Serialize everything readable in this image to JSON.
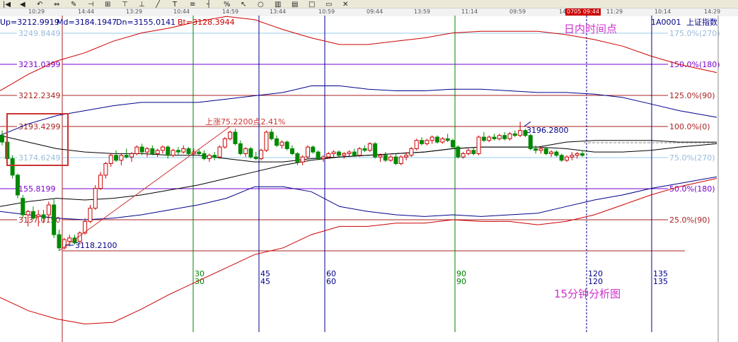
{
  "toolbar": {
    "time_axis_labels": [
      "10:29",
      "14:44",
      "13:29",
      "10:44",
      "14:59",
      "13:44",
      "10:59",
      "09:44",
      "13:59",
      "11:14",
      "09:59",
      "14:",
      "11:29",
      "10:14",
      "14:29"
    ],
    "current_time": "0705 09:44",
    "icons": [
      "first-icon",
      "prev-icon",
      "arrow-icon",
      "adjust-icon",
      "pin-icon",
      "mark-icon",
      "grid-icon",
      "tool-icon",
      "tool2-icon",
      "line-icon",
      "text-icon",
      "fib-icon",
      "ruler-icon",
      "percent-icon",
      "cursor-icon",
      "ring-icon",
      "bars-icon",
      "stack-icon",
      "box-icon",
      "scale-icon",
      "close-icon"
    ]
  },
  "header": {
    "up": "Up=3212.9919",
    "md": "Md=3184.1947",
    "dn": "Dn=3155.0141",
    "bt": "Bt=3128.3944",
    "code": "1A0001",
    "name": "上证指数"
  },
  "annotations": {
    "intraday_time_point": "日内时间点",
    "analysis_title": "15分钟分析图",
    "rise_label": "上涨75.2200点2.41%",
    "low_label": "3118.2100",
    "high_label": "3196.2800"
  },
  "colors": {
    "up_candle": "#cc0000",
    "down_candle": "#008800",
    "bollinger_upper": "#cc0000",
    "bollinger_mid": "#000000",
    "bollinger_lower": "#cc0000",
    "long_band": "#00008b",
    "fib_line_purple": "#7a00cc",
    "fib_line_red": "#aa2222",
    "fib_line_light": "#99ccee",
    "time_line_green": "#008000",
    "time_line_blue": "#000088",
    "highlight_box": "#cc3333",
    "annotation_magenta": "#cc33cc"
  },
  "chart_data": {
    "type": "candlestick",
    "interval": "15分钟",
    "y_levels": [
      {
        "price": "3249.8449",
        "pct": "175.0%(270)"
      },
      {
        "price": "3231.0399",
        "pct": "150.0%(180)"
      },
      {
        "price": "3212.2349",
        "pct": "125.0%(90)"
      },
      {
        "price": "3193.4299",
        "pct": "100.0%(0)"
      },
      {
        "price": "3174.6249",
        "pct": "75.0%(270)"
      },
      {
        "price": "155.8199",
        "pct": "50.0%(180)"
      },
      {
        "price": "3137.0150",
        "pct": "25.0%(90)"
      }
    ],
    "time_count_lines": [
      {
        "top": "30",
        "bottom": "30"
      },
      {
        "top": "45",
        "bottom": "45"
      },
      {
        "top": "60",
        "bottom": "60"
      },
      {
        "top": "90",
        "bottom": "90"
      },
      {
        "top": "120",
        "bottom": "120"
      },
      {
        "top": "135",
        "bottom": "135"
      }
    ],
    "ylim": [
      3105,
      3262
    ],
    "low": 3118.21,
    "high": 3196.28,
    "rise_points": 75.22,
    "rise_percent": 2.41,
    "candles": [
      [
        3188,
        3191,
        3182,
        3184
      ],
      [
        3184,
        3186,
        3172,
        3174
      ],
      [
        3174,
        3176,
        3162,
        3164
      ],
      [
        3164,
        3165,
        3150,
        3152
      ],
      [
        3150,
        3152,
        3138,
        3140
      ],
      [
        3140,
        3143,
        3133,
        3142
      ],
      [
        3142,
        3145,
        3137,
        3138
      ],
      [
        3139,
        3143,
        3133,
        3140
      ],
      [
        3140,
        3143,
        3135,
        3138
      ],
      [
        3140,
        3148,
        3138,
        3146
      ],
      [
        3146,
        3150,
        3126,
        3128
      ],
      [
        3128,
        3131,
        3118.21,
        3120
      ],
      [
        3120,
        3126,
        3119,
        3125
      ],
      [
        3124,
        3128,
        3121,
        3126
      ],
      [
        3126,
        3128,
        3122,
        3123
      ],
      [
        3124,
        3130,
        3122,
        3129
      ],
      [
        3129,
        3138,
        3128,
        3136
      ],
      [
        3136,
        3146,
        3135,
        3144
      ],
      [
        3144,
        3158,
        3143,
        3156
      ],
      [
        3156,
        3166,
        3155,
        3164
      ],
      [
        3164,
        3172,
        3162,
        3171
      ],
      [
        3171,
        3177,
        3169,
        3176
      ],
      [
        3176,
        3179,
        3172,
        3173
      ],
      [
        3173,
        3177,
        3170,
        3176
      ],
      [
        3176,
        3180,
        3174,
        3175
      ],
      [
        3175,
        3178,
        3172,
        3177
      ],
      [
        3177,
        3182,
        3176,
        3181
      ],
      [
        3181,
        3183,
        3176,
        3178
      ],
      [
        3178,
        3181,
        3175,
        3180
      ],
      [
        3180,
        3182,
        3176,
        3177
      ],
      [
        3177,
        3180,
        3175,
        3179
      ],
      [
        3179,
        3182,
        3177,
        3181
      ],
      [
        3181,
        3182,
        3174,
        3176
      ],
      [
        3176,
        3180,
        3175,
        3179
      ],
      [
        3179,
        3181,
        3176,
        3178
      ],
      [
        3178,
        3182,
        3177,
        3180
      ],
      [
        3180,
        3181,
        3176,
        3177
      ],
      [
        3177,
        3180,
        3176,
        3178
      ],
      [
        3178,
        3180,
        3176,
        3177
      ],
      [
        3177,
        3179,
        3173,
        3174
      ],
      [
        3174,
        3177,
        3172,
        3176
      ],
      [
        3176,
        3178,
        3173,
        3175
      ],
      [
        3175,
        3182,
        3174,
        3181
      ],
      [
        3181,
        3187,
        3180,
        3186
      ],
      [
        3186,
        3191,
        3185,
        3190
      ],
      [
        3190,
        3192,
        3182,
        3183
      ],
      [
        3183,
        3185,
        3176,
        3177
      ],
      [
        3177,
        3181,
        3175,
        3180
      ],
      [
        3180,
        3181,
        3174,
        3175
      ],
      [
        3175,
        3178,
        3173,
        3174
      ],
      [
        3174,
        3180,
        3173,
        3179
      ],
      [
        3179,
        3191,
        3178,
        3190
      ],
      [
        3190,
        3192,
        3185,
        3186
      ],
      [
        3186,
        3188,
        3181,
        3182
      ],
      [
        3182,
        3185,
        3180,
        3184
      ],
      [
        3184,
        3185,
        3179,
        3180
      ],
      [
        3180,
        3182,
        3176,
        3177
      ],
      [
        3177,
        3178,
        3170,
        3172
      ],
      [
        3172,
        3176,
        3170,
        3175
      ],
      [
        3175,
        3182,
        3174,
        3181
      ],
      [
        3181,
        3182,
        3177,
        3178
      ],
      [
        3178,
        3179,
        3173,
        3174
      ],
      [
        3174,
        3176,
        3172,
        3175
      ],
      [
        3175,
        3178,
        3174,
        3177
      ],
      [
        3177,
        3179,
        3175,
        3178
      ],
      [
        3178,
        3179,
        3175,
        3176
      ],
      [
        3176,
        3178,
        3174,
        3177
      ],
      [
        3177,
        3179,
        3175,
        3178
      ],
      [
        3178,
        3180,
        3175,
        3176
      ],
      [
        3176,
        3181,
        3175,
        3180
      ],
      [
        3180,
        3182,
        3178,
        3179
      ],
      [
        3179,
        3184,
        3178,
        3183
      ],
      [
        3183,
        3184,
        3174,
        3175
      ],
      [
        3175,
        3177,
        3172,
        3176
      ],
      [
        3176,
        3178,
        3172,
        3173
      ],
      [
        3173,
        3176,
        3172,
        3175
      ],
      [
        3175,
        3177,
        3170,
        3171
      ],
      [
        3171,
        3176,
        3170,
        3175
      ],
      [
        3175,
        3178,
        3173,
        3176
      ],
      [
        3176,
        3181,
        3175,
        3180
      ],
      [
        3180,
        3186,
        3179,
        3185
      ],
      [
        3185,
        3187,
        3182,
        3183
      ],
      [
        3183,
        3186,
        3182,
        3185
      ],
      [
        3185,
        3188,
        3183,
        3187
      ],
      [
        3187,
        3188,
        3183,
        3184
      ],
      [
        3184,
        3187,
        3183,
        3186
      ],
      [
        3186,
        3189,
        3184,
        3185
      ],
      [
        3185,
        3186,
        3180,
        3181
      ],
      [
        3181,
        3182,
        3174,
        3175
      ],
      [
        3175,
        3178,
        3174,
        3177
      ],
      [
        3177,
        3180,
        3176,
        3179
      ],
      [
        3179,
        3181,
        3176,
        3177
      ],
      [
        3177,
        3188,
        3176,
        3187
      ],
      [
        3187,
        3190,
        3184,
        3185
      ],
      [
        3185,
        3188,
        3184,
        3187
      ],
      [
        3187,
        3189,
        3185,
        3186
      ],
      [
        3186,
        3189,
        3185,
        3188
      ],
      [
        3188,
        3190,
        3185,
        3186
      ],
      [
        3186,
        3190,
        3185,
        3189
      ],
      [
        3189,
        3191,
        3187,
        3188
      ],
      [
        3188,
        3196.28,
        3187,
        3191
      ],
      [
        3191,
        3192,
        3187,
        3188
      ],
      [
        3188,
        3189,
        3179,
        3180
      ],
      [
        3180,
        3182,
        3177,
        3179
      ],
      [
        3179,
        3181,
        3177,
        3180
      ],
      [
        3180,
        3181,
        3176,
        3177
      ],
      [
        3177,
        3179,
        3175,
        3178
      ],
      [
        3178,
        3179,
        3175,
        3176
      ],
      [
        3176,
        3177,
        3172,
        3173
      ],
      [
        3173,
        3176,
        3172,
        3175
      ],
      [
        3175,
        3178,
        3173,
        3176
      ],
      [
        3176,
        3178,
        3174,
        3177
      ],
      [
        3177,
        3179,
        3175,
        3176
      ]
    ]
  }
}
